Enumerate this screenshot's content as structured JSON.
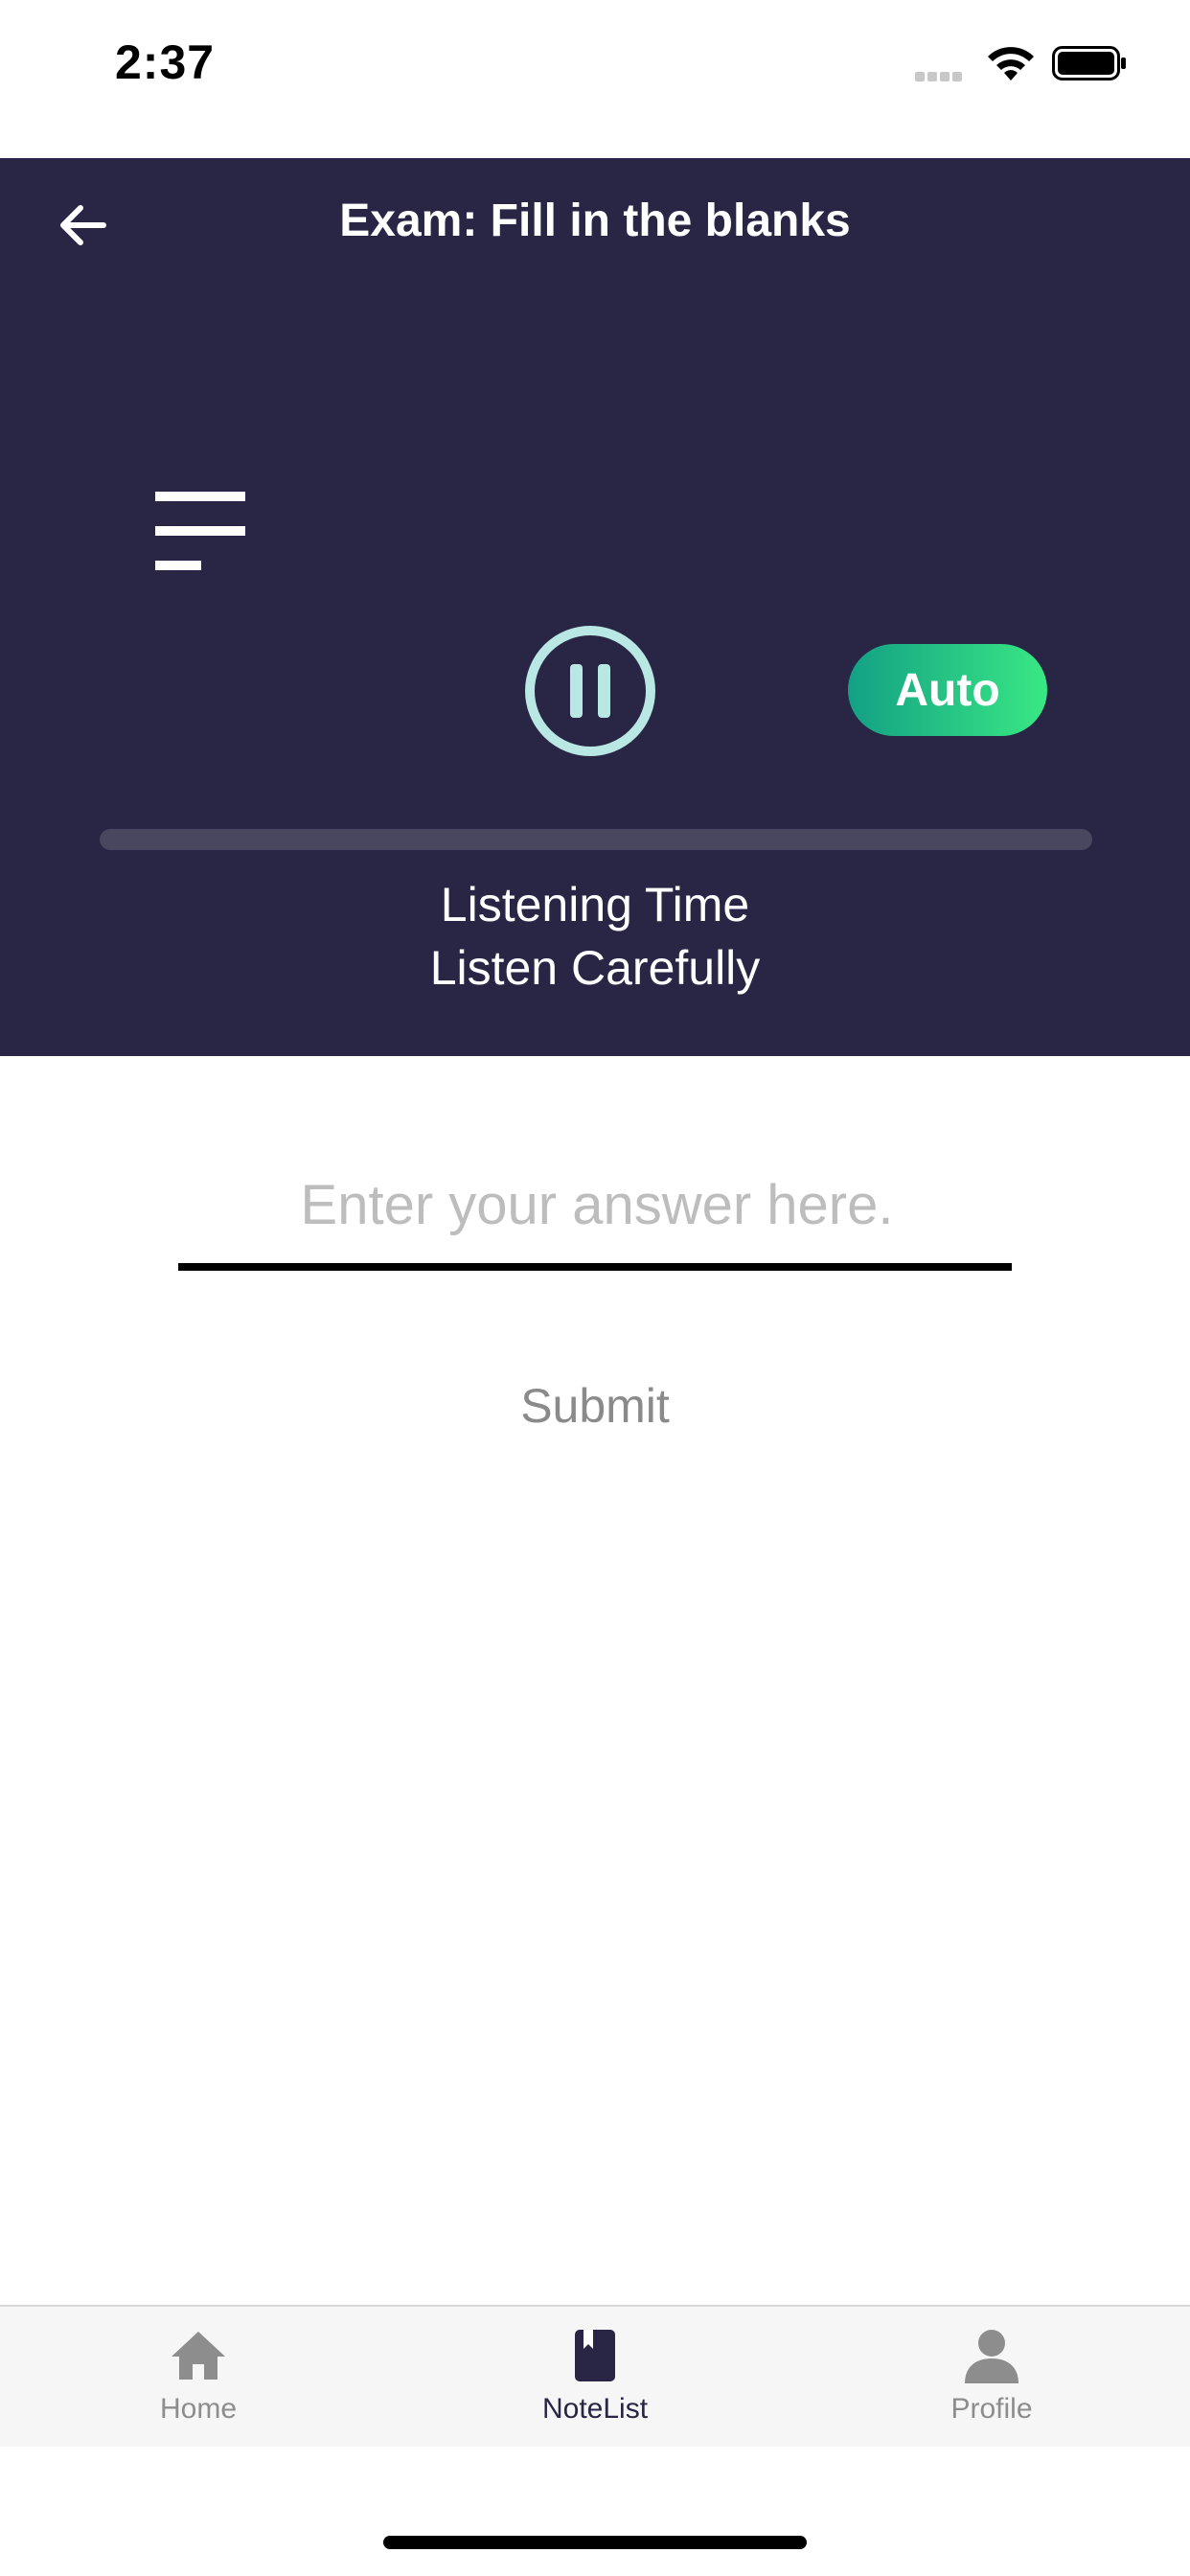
{
  "status_bar": {
    "time": "2:37",
    "icons": [
      "signal-icon",
      "wifi-icon",
      "battery-icon"
    ]
  },
  "header": {
    "title": "Exam: Fill in the blanks",
    "back_icon": "arrow-left-icon",
    "playlist_icon": "playlist-icon",
    "pause_icon": "pause-icon",
    "auto_label": "Auto",
    "progress": 0,
    "listening_title": "Listening Time",
    "listening_subtitle": "Listen Carefully"
  },
  "answer": {
    "placeholder": "Enter your answer here.",
    "value": "",
    "submit_label": "Submit"
  },
  "tabs": [
    {
      "label": "Home",
      "icon": "home-icon",
      "active": false
    },
    {
      "label": "NoteList",
      "icon": "notebook-icon",
      "active": true
    },
    {
      "label": "Profile",
      "icon": "person-icon",
      "active": false
    }
  ],
  "colors": {
    "header_bg": "#282545",
    "accent_teal": "#b9e8e4",
    "auto_gradient_start": "#13a085",
    "auto_gradient_end": "#39e883",
    "tab_active": "#282545",
    "tab_inactive": "#8d8d8d"
  }
}
